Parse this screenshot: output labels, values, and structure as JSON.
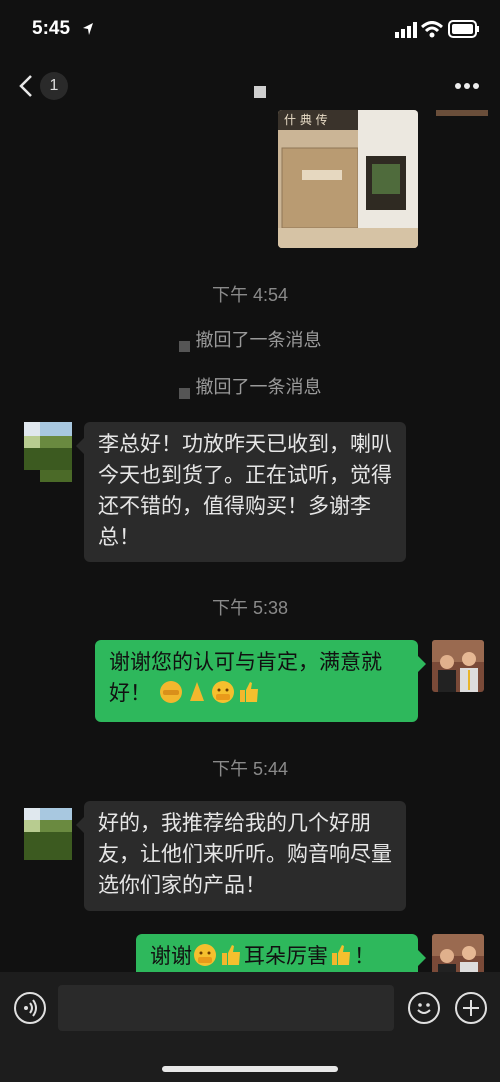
{
  "status_bar": {
    "time": "5:45"
  },
  "nav": {
    "unread_count": "1"
  },
  "messages": {
    "ts1": "下午 4:54",
    "recall1": "撤回了一条消息",
    "recall2": "撤回了一条消息",
    "msg1": "李总好！功放昨天已收到，喇叭今天也到货了。正在试听，觉得还不错的，值得购买！多谢李总！",
    "ts2": "下午 5:38",
    "msg2": "谢谢您的认可与肯定，满意就好！",
    "ts3": "下午 5:44",
    "msg3": "好的，我推荐给我的几个好朋友，让他们来听听。购音响尽量选你们家的产品！",
    "msg4_a": "谢谢",
    "msg4_b": "耳朵厉害",
    "msg4_c": "！"
  },
  "icons": {
    "back": "chevron-left-icon",
    "more": "more-dots-icon",
    "voice": "voice-icon",
    "emoji": "smiley-icon",
    "add": "plus-icon"
  },
  "colors": {
    "bubble_sent": "#2eb85c",
    "bubble_received": "#2b2b2b",
    "background": "#111111"
  }
}
